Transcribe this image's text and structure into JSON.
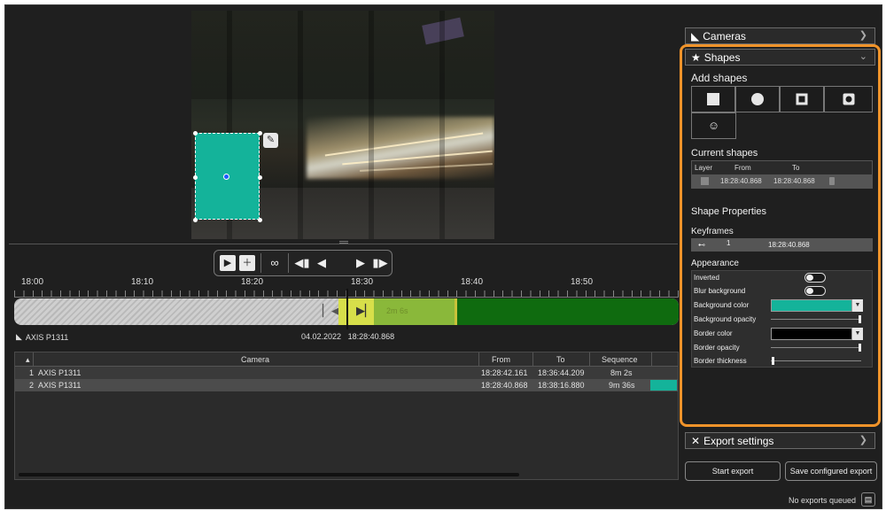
{
  "timeline": {
    "labels": [
      "18:00",
      "18:10",
      "18:20",
      "18:30",
      "18:40",
      "18:50"
    ],
    "segment_label": "2m 6s"
  },
  "camera_line": {
    "name": "AXIS P1311",
    "date": "04.02.2022",
    "time": "18:28:40.868"
  },
  "sequences": {
    "headers": {
      "camera": "Camera",
      "from": "From",
      "to": "To",
      "sequence": "Sequence"
    },
    "rows": [
      {
        "num": "1",
        "camera": "AXIS P1311",
        "from": "18:28:42.161",
        "to": "18:36:44.209",
        "sequence": "8m 2s"
      },
      {
        "num": "2",
        "camera": "AXIS P1311",
        "from": "18:28:40.868",
        "to": "18:38:16.880",
        "sequence": "9m 36s"
      }
    ]
  },
  "panel": {
    "cameras": "Cameras",
    "shapes": "Shapes",
    "add_shapes": "Add shapes",
    "current_shapes": "Current shapes",
    "current_shapes_headers": {
      "layer": "Layer",
      "from": "From",
      "to": "To"
    },
    "current_shape_row": {
      "from": "18:28:40.868",
      "to": "18:28:40.868"
    },
    "shape_properties": "Shape Properties",
    "keyframes": "Keyframes",
    "keyframe_row": {
      "index": "1",
      "time": "18:28:40.868"
    },
    "appearance": "Appearance",
    "props": {
      "inverted": "Inverted",
      "blur_background": "Blur background",
      "background_color": "Background color",
      "background_opacity": "Background opacity",
      "border_color": "Border color",
      "border_opacity": "Border opacity",
      "border_thickness": "Border thickness"
    },
    "colors": {
      "background": "#14b39a",
      "border": "#000000",
      "highlight": "#f0932a"
    },
    "export_settings": "Export settings"
  },
  "buttons": {
    "start_export": "Start export",
    "save_configured_export": "Save configured export"
  },
  "status": "No exports queued"
}
